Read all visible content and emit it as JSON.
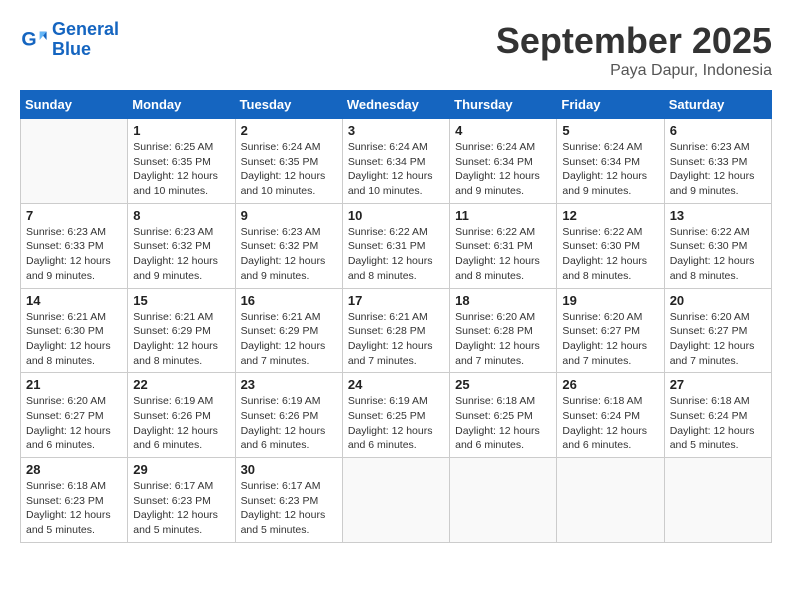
{
  "header": {
    "logo_line1": "General",
    "logo_line2": "Blue",
    "month": "September 2025",
    "location": "Paya Dapur, Indonesia"
  },
  "weekdays": [
    "Sunday",
    "Monday",
    "Tuesday",
    "Wednesday",
    "Thursday",
    "Friday",
    "Saturday"
  ],
  "weeks": [
    [
      {
        "day": "",
        "info": ""
      },
      {
        "day": "1",
        "info": "Sunrise: 6:25 AM\nSunset: 6:35 PM\nDaylight: 12 hours\nand 10 minutes."
      },
      {
        "day": "2",
        "info": "Sunrise: 6:24 AM\nSunset: 6:35 PM\nDaylight: 12 hours\nand 10 minutes."
      },
      {
        "day": "3",
        "info": "Sunrise: 6:24 AM\nSunset: 6:34 PM\nDaylight: 12 hours\nand 10 minutes."
      },
      {
        "day": "4",
        "info": "Sunrise: 6:24 AM\nSunset: 6:34 PM\nDaylight: 12 hours\nand 9 minutes."
      },
      {
        "day": "5",
        "info": "Sunrise: 6:24 AM\nSunset: 6:34 PM\nDaylight: 12 hours\nand 9 minutes."
      },
      {
        "day": "6",
        "info": "Sunrise: 6:23 AM\nSunset: 6:33 PM\nDaylight: 12 hours\nand 9 minutes."
      }
    ],
    [
      {
        "day": "7",
        "info": "Sunrise: 6:23 AM\nSunset: 6:33 PM\nDaylight: 12 hours\nand 9 minutes."
      },
      {
        "day": "8",
        "info": "Sunrise: 6:23 AM\nSunset: 6:32 PM\nDaylight: 12 hours\nand 9 minutes."
      },
      {
        "day": "9",
        "info": "Sunrise: 6:23 AM\nSunset: 6:32 PM\nDaylight: 12 hours\nand 9 minutes."
      },
      {
        "day": "10",
        "info": "Sunrise: 6:22 AM\nSunset: 6:31 PM\nDaylight: 12 hours\nand 8 minutes."
      },
      {
        "day": "11",
        "info": "Sunrise: 6:22 AM\nSunset: 6:31 PM\nDaylight: 12 hours\nand 8 minutes."
      },
      {
        "day": "12",
        "info": "Sunrise: 6:22 AM\nSunset: 6:30 PM\nDaylight: 12 hours\nand 8 minutes."
      },
      {
        "day": "13",
        "info": "Sunrise: 6:22 AM\nSunset: 6:30 PM\nDaylight: 12 hours\nand 8 minutes."
      }
    ],
    [
      {
        "day": "14",
        "info": "Sunrise: 6:21 AM\nSunset: 6:30 PM\nDaylight: 12 hours\nand 8 minutes."
      },
      {
        "day": "15",
        "info": "Sunrise: 6:21 AM\nSunset: 6:29 PM\nDaylight: 12 hours\nand 8 minutes."
      },
      {
        "day": "16",
        "info": "Sunrise: 6:21 AM\nSunset: 6:29 PM\nDaylight: 12 hours\nand 7 minutes."
      },
      {
        "day": "17",
        "info": "Sunrise: 6:21 AM\nSunset: 6:28 PM\nDaylight: 12 hours\nand 7 minutes."
      },
      {
        "day": "18",
        "info": "Sunrise: 6:20 AM\nSunset: 6:28 PM\nDaylight: 12 hours\nand 7 minutes."
      },
      {
        "day": "19",
        "info": "Sunrise: 6:20 AM\nSunset: 6:27 PM\nDaylight: 12 hours\nand 7 minutes."
      },
      {
        "day": "20",
        "info": "Sunrise: 6:20 AM\nSunset: 6:27 PM\nDaylight: 12 hours\nand 7 minutes."
      }
    ],
    [
      {
        "day": "21",
        "info": "Sunrise: 6:20 AM\nSunset: 6:27 PM\nDaylight: 12 hours\nand 6 minutes."
      },
      {
        "day": "22",
        "info": "Sunrise: 6:19 AM\nSunset: 6:26 PM\nDaylight: 12 hours\nand 6 minutes."
      },
      {
        "day": "23",
        "info": "Sunrise: 6:19 AM\nSunset: 6:26 PM\nDaylight: 12 hours\nand 6 minutes."
      },
      {
        "day": "24",
        "info": "Sunrise: 6:19 AM\nSunset: 6:25 PM\nDaylight: 12 hours\nand 6 minutes."
      },
      {
        "day": "25",
        "info": "Sunrise: 6:18 AM\nSunset: 6:25 PM\nDaylight: 12 hours\nand 6 minutes."
      },
      {
        "day": "26",
        "info": "Sunrise: 6:18 AM\nSunset: 6:24 PM\nDaylight: 12 hours\nand 6 minutes."
      },
      {
        "day": "27",
        "info": "Sunrise: 6:18 AM\nSunset: 6:24 PM\nDaylight: 12 hours\nand 5 minutes."
      }
    ],
    [
      {
        "day": "28",
        "info": "Sunrise: 6:18 AM\nSunset: 6:23 PM\nDaylight: 12 hours\nand 5 minutes."
      },
      {
        "day": "29",
        "info": "Sunrise: 6:17 AM\nSunset: 6:23 PM\nDaylight: 12 hours\nand 5 minutes."
      },
      {
        "day": "30",
        "info": "Sunrise: 6:17 AM\nSunset: 6:23 PM\nDaylight: 12 hours\nand 5 minutes."
      },
      {
        "day": "",
        "info": ""
      },
      {
        "day": "",
        "info": ""
      },
      {
        "day": "",
        "info": ""
      },
      {
        "day": "",
        "info": ""
      }
    ]
  ]
}
